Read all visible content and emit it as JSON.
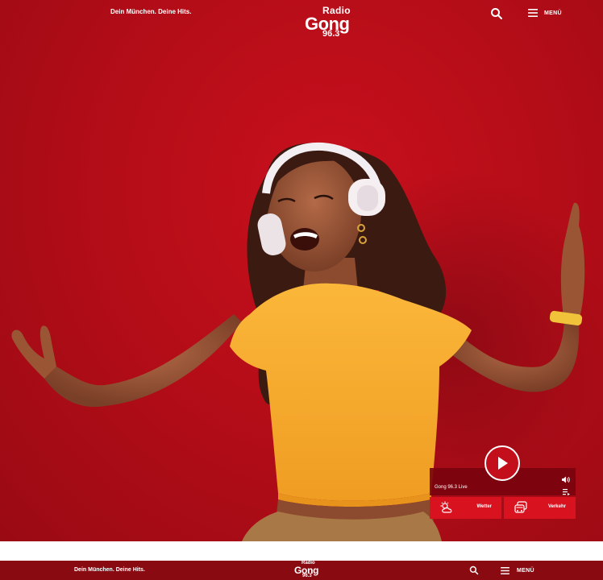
{
  "header": {
    "tagline": "Dein München. Deine Hits.",
    "logo": {
      "line1": "Radio",
      "line2": "Gong",
      "line3": "96.3"
    },
    "search_icon": "search-icon",
    "menu_icon": "hamburger-icon",
    "menu_label": "MENÜ"
  },
  "player": {
    "play_icon": "play-icon",
    "station": "Gong 96.3 Live",
    "volume_icon": "volume-icon",
    "queue_icon": "playlist-icon"
  },
  "quicklinks": [
    {
      "label": "Wetter",
      "icon": "weather-icon"
    },
    {
      "label": "Verkehr",
      "icon": "traffic-icon"
    }
  ],
  "sticky_header": {
    "tagline": "Dein München. Deine Hits.",
    "logo": {
      "line1": "Radio",
      "line2": "Gong",
      "line3": "96.3"
    },
    "menu_label": "MENÜ"
  },
  "colors": {
    "brand_red": "#c8101d",
    "dark_red": "#8a0a12",
    "button_red": "#d8121f",
    "shirt_yellow": "#f6ab2d"
  }
}
